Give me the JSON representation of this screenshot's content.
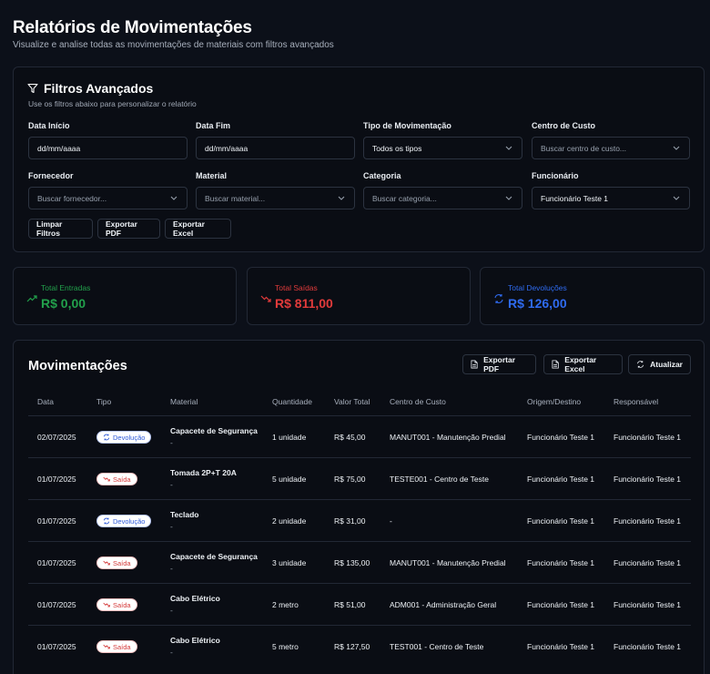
{
  "header": {
    "title": "Relatórios de Movimentações",
    "subtitle": "Visualize e analise todas as movimentações de materiais com filtros avançados"
  },
  "filters": {
    "title": "Filtros Avançados",
    "subtitle": "Use os filtros abaixo para personalizar o relatório",
    "data_inicio": {
      "label": "Data Início",
      "value": "dd/mm/aaaa"
    },
    "data_fim": {
      "label": "Data Fim",
      "value": "dd/mm/aaaa"
    },
    "tipo": {
      "label": "Tipo de Movimentação",
      "value": "Todos os tipos"
    },
    "centro_custo": {
      "label": "Centro de Custo",
      "placeholder": "Buscar centro de custo..."
    },
    "fornecedor": {
      "label": "Fornecedor",
      "placeholder": "Buscar fornecedor..."
    },
    "material": {
      "label": "Material",
      "placeholder": "Buscar material..."
    },
    "categoria": {
      "label": "Categoria",
      "placeholder": "Buscar categoria..."
    },
    "funcionario": {
      "label": "Funcionário",
      "value": "Funcionário Teste 1"
    },
    "buttons": {
      "clear": "Limpar Filtros",
      "pdf": "Exportar PDF",
      "excel": "Exportar Excel"
    }
  },
  "stats": {
    "entradas": {
      "label": "Total Entradas",
      "value": "R$ 0,00",
      "color": "#22a04b"
    },
    "saidas": {
      "label": "Total Saídas",
      "value": "R$ 811,00",
      "color": "#e23b3b"
    },
    "devolucoes": {
      "label": "Total Devoluções",
      "value": "R$ 126,00",
      "color": "#2f6bf0"
    }
  },
  "moves": {
    "title": "Movimentações",
    "buttons": {
      "pdf": "Exportar PDF",
      "excel": "Exportar Excel",
      "refresh": "Atualizar"
    },
    "columns": [
      "Data",
      "Tipo",
      "Material",
      "Quantidade",
      "Valor Total",
      "Centro de Custo",
      "Origem/Destino",
      "Responsável"
    ],
    "rows": [
      {
        "date": "02/07/2025",
        "type": "Devolução",
        "kind": "dev",
        "material": "Capacete de Segurança",
        "sub": "-",
        "qty": "1 unidade",
        "total": "R$ 45,00",
        "cc": "MANUT001 - Manutenção Predial",
        "origin": "Funcionário Teste 1",
        "resp": "Funcionário Teste 1"
      },
      {
        "date": "01/07/2025",
        "type": "Saída",
        "kind": "sai",
        "material": "Tomada 2P+T 20A",
        "sub": "-",
        "qty": "5 unidade",
        "total": "R$ 75,00",
        "cc": "TESTE001 - Centro de Teste",
        "origin": "Funcionário Teste 1",
        "resp": "Funcionário Teste 1"
      },
      {
        "date": "01/07/2025",
        "type": "Devolução",
        "kind": "dev",
        "material": "Teclado",
        "sub": "-",
        "qty": "2 unidade",
        "total": "R$ 31,00",
        "cc": "-",
        "origin": "Funcionário Teste 1",
        "resp": "Funcionário Teste 1"
      },
      {
        "date": "01/07/2025",
        "type": "Saída",
        "kind": "sai",
        "material": "Capacete de Segurança",
        "sub": "-",
        "qty": "3 unidade",
        "total": "R$ 135,00",
        "cc": "MANUT001 - Manutenção Predial",
        "origin": "Funcionário Teste 1",
        "resp": "Funcionário Teste 1"
      },
      {
        "date": "01/07/2025",
        "type": "Saída",
        "kind": "sai",
        "material": "Cabo Elétrico",
        "sub": "-",
        "qty": "2 metro",
        "total": "R$ 51,00",
        "cc": "ADM001 - Administração Geral",
        "origin": "Funcionário Teste 1",
        "resp": "Funcionário Teste 1"
      },
      {
        "date": "01/07/2025",
        "type": "Saída",
        "kind": "sai",
        "material": "Cabo Elétrico",
        "sub": "-",
        "qty": "5 metro",
        "total": "R$ 127,50",
        "cc": "TEST001 - Centro de Teste",
        "origin": "Funcionário Teste 1",
        "resp": "Funcionário Teste 1"
      }
    ]
  }
}
